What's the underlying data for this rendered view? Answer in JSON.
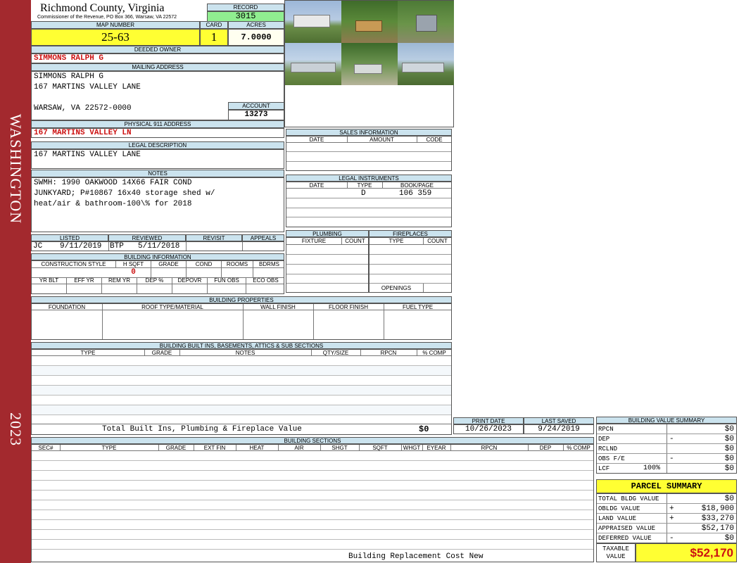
{
  "sidebar": {
    "district": "WASHINGTON",
    "year": "2023"
  },
  "header": {
    "county": "Richmond County, Virginia",
    "commissioner": "Commissioner of the Revenue, PO Box 366, Warsaw, VA 22572"
  },
  "record": {
    "label": "RECORD",
    "value": "3015"
  },
  "map_number": {
    "label": "MAP NUMBER",
    "value": "25-63"
  },
  "card": {
    "label": "CARD",
    "value": "1"
  },
  "acres": {
    "label": "ACRES",
    "value": "7.0000"
  },
  "deeded_owner": {
    "label": "DEEDED OWNER",
    "value": "SIMMONS RALPH G"
  },
  "mailing": {
    "label": "MAILING ADDRESS",
    "line1": "SIMMONS RALPH G",
    "line2": "167 MARTINS VALLEY LANE",
    "line3": "WARSAW, VA 22572-0000"
  },
  "account": {
    "label": "ACCOUNT",
    "value": "13273"
  },
  "physical": {
    "label": "PHYSICAL 911 ADDRESS",
    "value": "167 MARTINS VALLEY LN"
  },
  "legal": {
    "label": "LEGAL DESCRIPTION",
    "value": "167 MARTINS VALLEY LANE"
  },
  "notes": {
    "label": "NOTES",
    "line1": "SWMH: 1990 OAKWOOD 14X66 FAIR COND",
    "line2": "JUNKYARD; P#10867 16x40 storage shed w/",
    "line3": "heat/air & bathroom-100\\% for 2018"
  },
  "listing": {
    "listed_label": "LISTED",
    "reviewed_label": "REVIEWED",
    "revisit_label": "REVISIT",
    "appeals_label": "APPEALS",
    "listed_by": "JC",
    "listed_date": "9/11/2019",
    "reviewed_by": "BTP",
    "reviewed_date": "5/11/2018"
  },
  "building_info": {
    "label": "BUILDING INFORMATION",
    "cols": [
      "CONSTRUCTION STYLE",
      "H SQFT",
      "GRADE",
      "COND",
      "ROOMS",
      "BDRMS"
    ],
    "hsqft": "0",
    "cols2": [
      "YR BLT",
      "EFF YR",
      "REM YR",
      "DEP %",
      "DEPOVR",
      "FUN OBS",
      "ECO OBS"
    ]
  },
  "sales": {
    "label": "SALES INFORMATION",
    "cols": [
      "DATE",
      "AMOUNT",
      "CODE"
    ]
  },
  "instruments": {
    "label": "LEGAL INSTRUMENTS",
    "cols": [
      "DATE",
      "TYPE",
      "BOOK/PAGE"
    ],
    "type": "D",
    "bookpage": "106 359"
  },
  "plumbing": {
    "label": "PLUMBING",
    "cols": [
      "FIXTURE",
      "COUNT"
    ]
  },
  "fireplaces": {
    "label": "FIREPLACES",
    "cols": [
      "TYPE",
      "COUNT"
    ],
    "openings": "OPENINGS"
  },
  "properties": {
    "label": "BUILDING PROPERTIES",
    "cols": [
      "FOUNDATION",
      "ROOF TYPE/MATERIAL",
      "WALL FINISH",
      "FLOOR FINISH",
      "FUEL TYPE"
    ]
  },
  "builtins": {
    "label": "BUILDING BUILT INS, BASEMENTS, ATTICS & SUB SECTIONS",
    "cols": [
      "TYPE",
      "GRADE",
      "NOTES",
      "QTY/SIZE",
      "RPCN",
      "% COMP"
    ],
    "total_label": "Total Built Ins, Plumbing & Fireplace Value",
    "total_value": "$0"
  },
  "dates": {
    "print_label": "PRINT DATE",
    "print_value": "10/26/2023",
    "saved_label": "LAST SAVED",
    "saved_value": "9/24/2019"
  },
  "sections": {
    "label": "BUILDING SECTIONS",
    "cols": [
      "SEC#",
      "TYPE",
      "GRADE",
      "EXT FIN",
      "HEAT",
      "AIR",
      "SHGT",
      "SQFT",
      "WHGT",
      "EYEAR",
      "RPCN",
      "DEP",
      "% COMP"
    ],
    "footer": "Building Replacement Cost New"
  },
  "bvs": {
    "label": "BUILDING VALUE SUMMARY",
    "rows": [
      {
        "label": "RPCN",
        "sign": "",
        "value": "$0"
      },
      {
        "label": "DEP",
        "sign": "-",
        "value": "$0"
      },
      {
        "label": "RCLND",
        "sign": "",
        "value": "$0"
      },
      {
        "label": "OBS F/E",
        "sign": "-",
        "value": "$0"
      },
      {
        "label": "LCF",
        "sign": "",
        "value": "$0",
        "pct": "100%"
      }
    ]
  },
  "parcel": {
    "label": "PARCEL SUMMARY",
    "rows": [
      {
        "label": "TOTAL BLDG VALUE",
        "sign": "",
        "value": "$0"
      },
      {
        "label": "OBLDG VALUE",
        "sign": "+",
        "value": "$18,900"
      },
      {
        "label": "LAND VALUE",
        "sign": "+",
        "value": "$33,270"
      },
      {
        "label": "APPRAISED VALUE",
        "sign": "",
        "value": "$52,170"
      },
      {
        "label": "DEFERRED VALUE",
        "sign": "-",
        "value": "$0"
      }
    ],
    "taxable_label1": "TAXABLE",
    "taxable_label2": "VALUE",
    "taxable_value": "$52,170"
  },
  "colors": {
    "sidebar": "#a3292e",
    "header_fill": "#cbe3ee",
    "highlight": "#ffff33",
    "record_fill": "#90ee90",
    "value_red": "#cc1111"
  }
}
